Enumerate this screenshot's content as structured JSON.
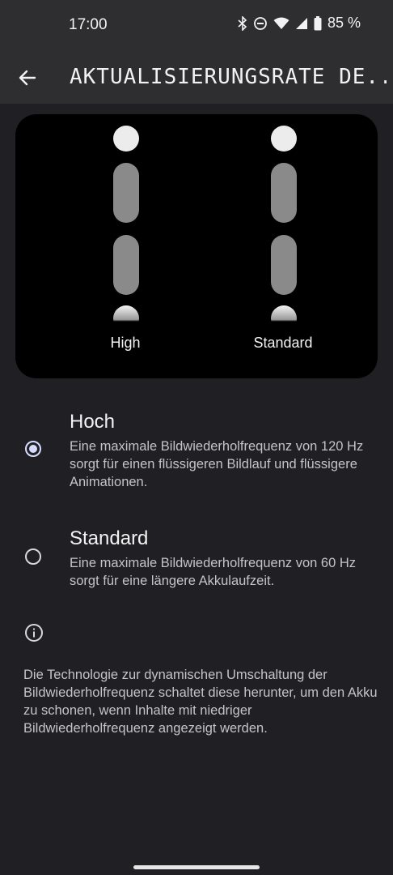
{
  "status_bar": {
    "time": "17:00",
    "battery": "85 %",
    "icons": [
      "bluetooth-icon",
      "do-not-disturb-icon",
      "wifi-icon",
      "signal-icon",
      "battery-icon"
    ]
  },
  "app_bar": {
    "title": "AKTUALISIERUNGSRATE DE..."
  },
  "preview": {
    "left_label": "High",
    "right_label": "Standard"
  },
  "options": [
    {
      "title": "Hoch",
      "description": "Eine maximale Bildwiederholfrequenz von 120 Hz sorgt für einen flüssigeren Bildlauf und flüssigere Animationen.",
      "selected": true
    },
    {
      "title": "Standard",
      "description": "Eine maximale Bildwiederholfrequenz von 60 Hz sorgt für eine längere Akkulaufzeit.",
      "selected": false
    }
  ],
  "footer": {
    "text": "Die Technologie zur dynamischen Umschaltung der Bildwiederholfrequenz schaltet diese herunter, um den Akku zu schonen, wenn Inhalte mit niedriger Bildwiederholfrequenz angezeigt werden."
  },
  "colors": {
    "background": "#202024",
    "app_bar": "#2e2e31",
    "accent": "#d6dcff"
  }
}
